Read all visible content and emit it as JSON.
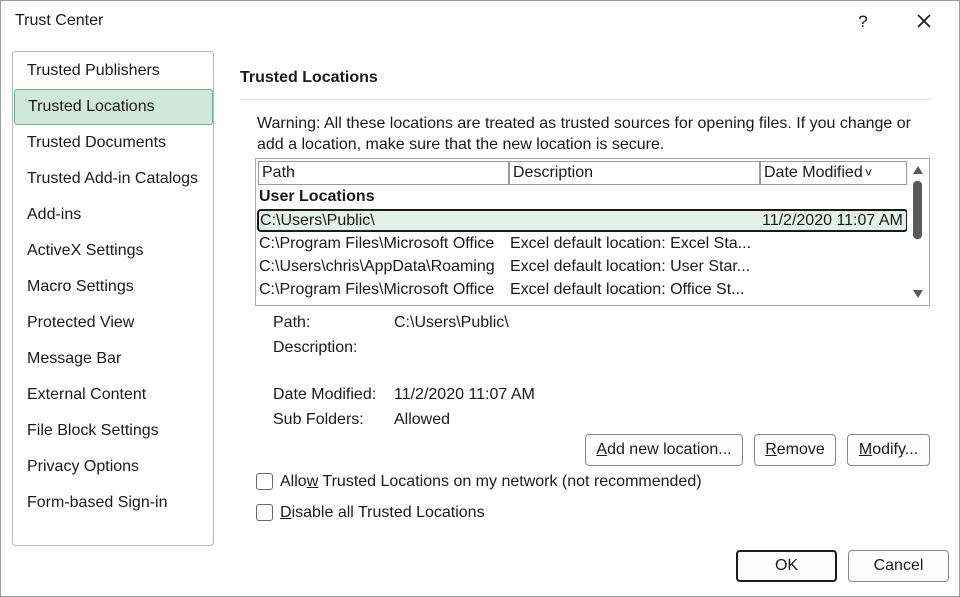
{
  "window": {
    "title": "Trust Center",
    "help_label": "?"
  },
  "sidebar": {
    "items": [
      {
        "label": "Trusted Publishers"
      },
      {
        "label": "Trusted Locations"
      },
      {
        "label": "Trusted Documents"
      },
      {
        "label": "Trusted Add-in Catalogs"
      },
      {
        "label": "Add-ins"
      },
      {
        "label": "ActiveX Settings"
      },
      {
        "label": "Macro Settings"
      },
      {
        "label": "Protected View"
      },
      {
        "label": "Message Bar"
      },
      {
        "label": "External Content"
      },
      {
        "label": "File Block Settings"
      },
      {
        "label": "Privacy Options"
      },
      {
        "label": "Form-based Sign-in"
      }
    ],
    "selected": "Trusted Locations"
  },
  "section": {
    "title": "Trusted Locations",
    "warning": "Warning: All these locations are treated as trusted sources for opening files.  If you change or add a location, make sure that the new location is secure."
  },
  "list": {
    "columns": {
      "path": "Path",
      "description": "Description",
      "date": "Date Modified"
    },
    "sort_indicator": "˅",
    "group": "User Locations",
    "rows": [
      {
        "path": "C:\\Users\\Public\\",
        "description": "",
        "date": "11/2/2020 11:07 AM"
      },
      {
        "path": "C:\\Program Files\\Microsoft Office",
        "description": "Excel default location: Excel Sta...",
        "date": ""
      },
      {
        "path": "C:\\Users\\chris\\AppData\\Roaming",
        "description": "Excel default location: User Star...",
        "date": ""
      },
      {
        "path": "C:\\Program Files\\Microsoft Office",
        "description": "Excel default location: Office St...",
        "date": ""
      }
    ]
  },
  "details": {
    "path_label": "Path:",
    "path_value": "C:\\Users\\Public\\",
    "description_label": "Description:",
    "description_value": "",
    "date_label": "Date Modified:",
    "date_value": "11/2/2020 11:07 AM",
    "subfolders_label": "Sub Folders:",
    "subfolders_value": "Allowed"
  },
  "buttons": {
    "add": {
      "pre": "",
      "key": "A",
      "post": "dd new location..."
    },
    "remove": {
      "pre": "",
      "key": "R",
      "post": "emove"
    },
    "modify": {
      "pre": "",
      "key": "M",
      "post": "odify..."
    },
    "ok": "OK",
    "cancel": "Cancel"
  },
  "checkboxes": {
    "network": {
      "pre": "Allo",
      "key": "w",
      "post": " Trusted Locations on my network (not recommended)",
      "checked": false
    },
    "disable": {
      "pre": "",
      "key": "D",
      "post": "isable all Trusted Locations",
      "checked": false
    }
  },
  "colors": {
    "selection_fill": "#cfe8db",
    "selection_border": "#6fb394",
    "row_highlight": "#e3f1ea"
  }
}
